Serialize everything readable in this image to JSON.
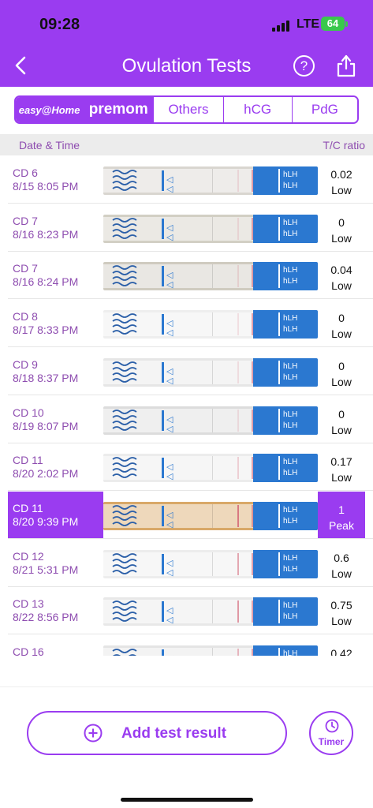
{
  "status": {
    "time": "09:28",
    "network": "LTE",
    "battery": "64"
  },
  "header": {
    "title": "Ovulation Tests",
    "help_icon": "question-circle-icon",
    "share_icon": "share-icon",
    "back_icon": "chevron-left-icon"
  },
  "tabs": [
    {
      "label": "easy@Home",
      "active": true
    },
    {
      "label": "premom",
      "active": true
    },
    {
      "label": "Others",
      "active": false
    },
    {
      "label": "hCG",
      "active": false
    },
    {
      "label": "PdG",
      "active": false
    }
  ],
  "table": {
    "col_date": "Date & Time",
    "col_ratio": "T/C ratio"
  },
  "rows": [
    {
      "cd": "CD 6",
      "datetime": "8/15 8:05 PM",
      "ratio": "0.02",
      "level": "Low",
      "strip_bg": "#d9d6d0"
    },
    {
      "cd": "CD 7",
      "datetime": "8/16 8:23 PM",
      "ratio": "0",
      "level": "Low",
      "strip_bg": "#d2cfc4"
    },
    {
      "cd": "CD 7",
      "datetime": "8/16 8:24 PM",
      "ratio": "0.04",
      "level": "Low",
      "strip_bg": "#cfcbc0"
    },
    {
      "cd": "CD 8",
      "datetime": "8/17 8:33 PM",
      "ratio": "0",
      "level": "Low",
      "strip_bg": "#eeeeee"
    },
    {
      "cd": "CD 9",
      "datetime": "8/18 8:37 PM",
      "ratio": "0",
      "level": "Low",
      "strip_bg": "#e6e6e6"
    },
    {
      "cd": "CD 10",
      "datetime": "8/19 8:07 PM",
      "ratio": "0",
      "level": "Low",
      "strip_bg": "#dcdcdc"
    },
    {
      "cd": "CD 11",
      "datetime": "8/20 2:02 PM",
      "ratio": "0.17",
      "level": "Low",
      "strip_bg": "#ececec"
    },
    {
      "cd": "CD 11",
      "datetime": "8/20 9:39 PM",
      "ratio": "1",
      "level": "Peak",
      "strip_bg": "#d9a868",
      "selected": true
    },
    {
      "cd": "CD 12",
      "datetime": "8/21 5:31 PM",
      "ratio": "0.6",
      "level": "Low",
      "strip_bg": "#ededed"
    },
    {
      "cd": "CD 13",
      "datetime": "8/22 8:56 PM",
      "ratio": "0.75",
      "level": "Low",
      "strip_bg": "#e8e8e8"
    },
    {
      "cd": "CD 16",
      "datetime": "",
      "ratio": "0.42",
      "level": "",
      "strip_bg": "#e4e4e4"
    }
  ],
  "strip": {
    "brand_text": "hLH"
  },
  "footer": {
    "add_label": "Add test result",
    "add_icon": "plus-circle-icon",
    "timer_label": "Timer",
    "timer_icon": "clock-icon"
  },
  "colors": {
    "accent": "#9a3cf0",
    "cd_text": "#8e4db0",
    "strip_blue": "#2b78d0"
  }
}
